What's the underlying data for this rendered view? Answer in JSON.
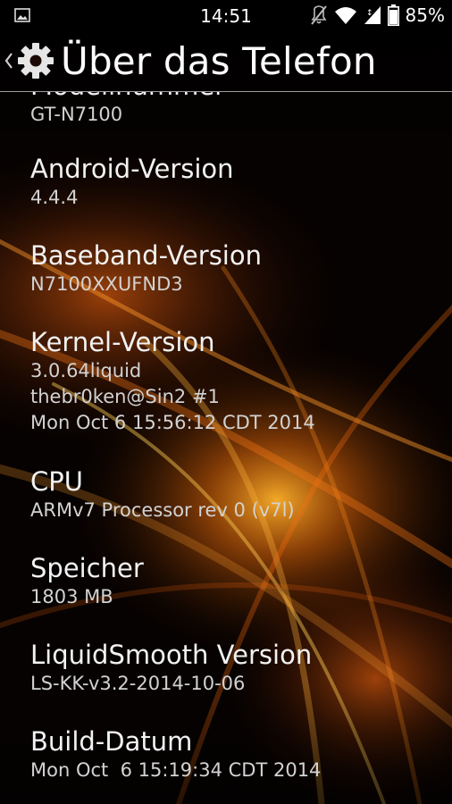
{
  "status_bar": {
    "time": "14:51",
    "battery_percent": "85%",
    "icons": [
      "image-notification-icon",
      "mute-icon",
      "wifi-icon",
      "signal-icon",
      "battery-icon"
    ]
  },
  "action_bar": {
    "title": "Über das Telefon",
    "icons": [
      "up-caret-icon",
      "settings-gear-icon"
    ]
  },
  "items": [
    {
      "title": "Modellnummer",
      "summary": "GT-N7100"
    },
    {
      "title": "Android-Version",
      "summary": "4.4.4"
    },
    {
      "title": "Baseband-Version",
      "summary": "N7100XXUFND3"
    },
    {
      "title": "Kernel-Version",
      "summary": "3.0.64liquid\nthebr0ken@Sin2 #1\nMon Oct 6 15:56:12 CDT 2014"
    },
    {
      "title": "CPU",
      "summary": "ARMv7 Processor rev 0 (v7l)"
    },
    {
      "title": "Speicher",
      "summary": "1803 MB"
    },
    {
      "title": "LiquidSmooth Version",
      "summary": "LS-KK-v3.2-2014-10-06"
    },
    {
      "title": "Build-Datum",
      "summary": "Mon Oct  6 15:19:34 CDT 2014"
    }
  ],
  "colors": {
    "background": "#050201",
    "accent_orange": "#ff8a10",
    "divider": "#9a9a9a"
  }
}
